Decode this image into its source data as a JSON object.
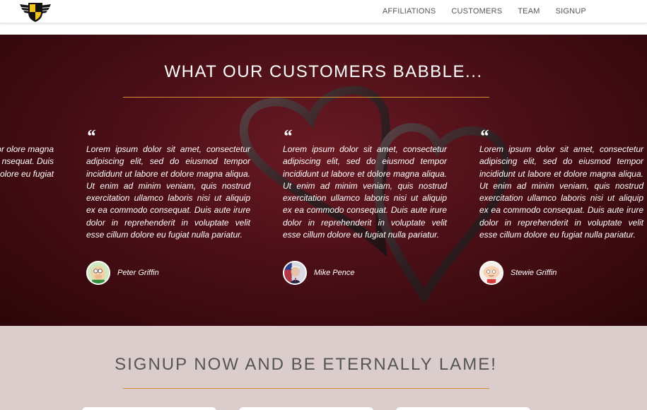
{
  "nav": {
    "logo_icon": "winged-shield-logo",
    "links": [
      "AFFILIATIONS",
      "CUSTOMERS",
      "TEAM",
      "SIGNUP"
    ]
  },
  "testimonials": {
    "title": "WHAT OUR CUSTOMERS BABBLE...",
    "quote_mark": "“",
    "partial_text": "t, consectetur smod tempor olore magna veniam, quis laboris nisi ut nsequat. Duis eprehenderit in olore eu fugiat",
    "cards": [
      {
        "text": "Lorem ipsum dolor sit amet, consectetur adipiscing elit, sed do eiusmod tempor incididunt ut labore et dolore magna aliqua. Ut enim ad minim veniam, quis nostrud exercitation ullamco laboris nisi ut aliquip ex ea commodo consequat. Duis aute irure dolor in reprehenderit in voluptate velit esse cillum dolore eu fugiat nulla pariatur.",
        "author": "Peter Griffin",
        "avatar_icon": "peter-griffin-avatar"
      },
      {
        "text": "Lorem ipsum dolor sit amet, consectetur adipiscing elit, sed do eiusmod tempor incididunt ut labore et dolore magna aliqua. Ut enim ad minim veniam, quis nostrud exercitation ullamco laboris nisi ut aliquip ex ea commodo consequat. Duis aute irure dolor in reprehenderit in voluptate velit esse cillum dolore eu fugiat nulla pariatur.",
        "author": "Mike Pence",
        "avatar_icon": "mike-pence-avatar"
      },
      {
        "text": "Lorem ipsum dolor sit amet, consectetur adipiscing elit, sed do eiusmod tempor incididunt ut labore et dolore magna aliqua. Ut enim ad minim veniam, quis nostrud exercitation ullamco laboris nisi ut aliquip ex ea commodo consequat. Duis aute irure dolor in reprehenderit in voluptate velit esse cillum dolore eu fugiat nulla pariatur.",
        "author": "Stewie Griffin",
        "avatar_icon": "stewie-griffin-avatar"
      }
    ]
  },
  "signup": {
    "title": "SIGNUP NOW AND BE ETERNALLY LAME!"
  },
  "colors": {
    "accent_rule": "#d88a35",
    "testimonial_bg": "#4b0f17",
    "signup_bg": "#dccdcd"
  }
}
